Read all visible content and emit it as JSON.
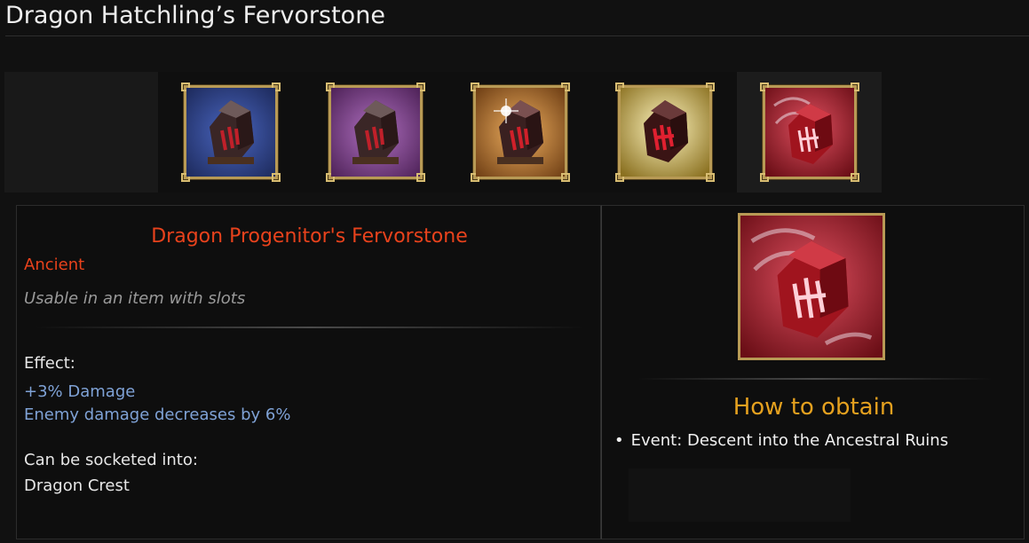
{
  "page": {
    "title": "Dragon Hatchling’s Fervorstone"
  },
  "tiers": [
    {
      "name": "tier-1",
      "bg": "#2c3f86"
    },
    {
      "name": "tier-2",
      "bg": "#7a3d86"
    },
    {
      "name": "tier-3",
      "bg": "#b7762e"
    },
    {
      "name": "tier-4",
      "bg": "#e3c24d"
    },
    {
      "name": "tier-5",
      "bg": "#b21f27"
    }
  ],
  "item": {
    "name": "Dragon Progenitor's Fervorstone",
    "rarity": "Ancient",
    "usage": "Usable in an item with slots",
    "effect_label": "Effect:",
    "effects": [
      "+3% Damage",
      "Enemy damage decreases by 6%"
    ],
    "socket_label": "Can be socketed into:",
    "socket_value": "Dragon Crest"
  },
  "obtain": {
    "title": "How to obtain",
    "items": [
      "Event: Descent into the Ancestral Ruins"
    ]
  },
  "colors": {
    "rarity": "#e8421c",
    "effect": "#7fa2d6",
    "obtain_title": "#e5a11f",
    "frame_gold": "#b89a55"
  }
}
